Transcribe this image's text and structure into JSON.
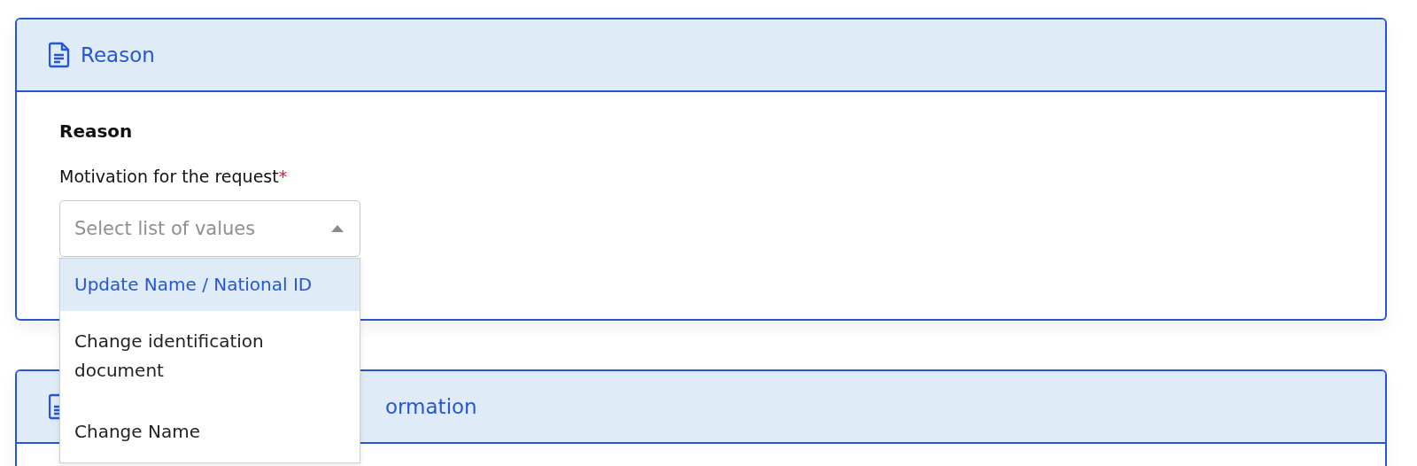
{
  "panels": [
    {
      "title": "Reason",
      "section_title": "Reason",
      "field": {
        "label": "Motivation for the request",
        "required_mark": "*",
        "placeholder": "Select list of values",
        "expanded": true,
        "options": [
          {
            "label": "Update Name / National ID",
            "selected": true
          },
          {
            "label": "Change identification document",
            "selected": false
          },
          {
            "label": "Change Name",
            "selected": false
          }
        ]
      }
    },
    {
      "title": "ormation"
    }
  ]
}
